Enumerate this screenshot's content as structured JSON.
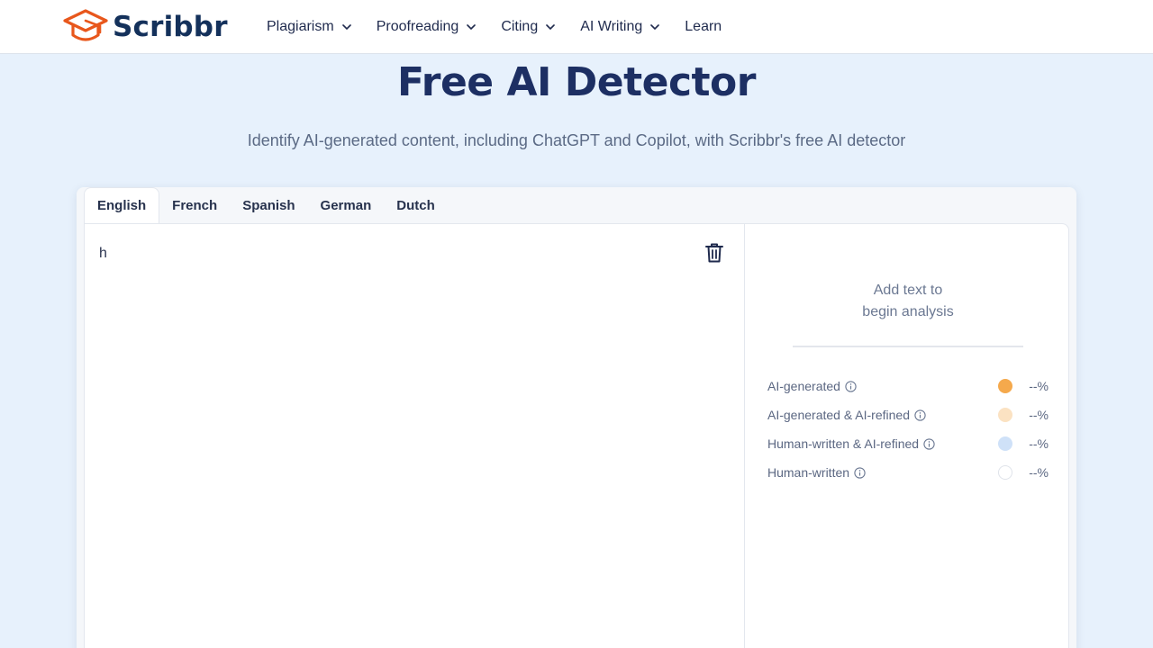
{
  "brand": {
    "name": "Scribbr",
    "color": "#e8571c",
    "text_color": "#14315b"
  },
  "nav": [
    {
      "label": "Plagiarism",
      "has_dropdown": true
    },
    {
      "label": "Proofreading",
      "has_dropdown": true
    },
    {
      "label": "Citing",
      "has_dropdown": true
    },
    {
      "label": "AI Writing",
      "has_dropdown": true
    },
    {
      "label": "Learn",
      "has_dropdown": false
    }
  ],
  "hero": {
    "title": "Free AI Detector",
    "subtitle": "Identify AI-generated content, including ChatGPT and Copilot, with Scribbr's free AI detector"
  },
  "tabs": [
    {
      "label": "English",
      "active": true
    },
    {
      "label": "French",
      "active": false
    },
    {
      "label": "Spanish",
      "active": false
    },
    {
      "label": "German",
      "active": false
    },
    {
      "label": "Dutch",
      "active": false
    }
  ],
  "editor": {
    "text": "h",
    "clear_icon": "trash-icon"
  },
  "results": {
    "empty_line1": "Add text to",
    "empty_line2": "begin analysis",
    "rows": [
      {
        "label": "AI-generated",
        "value": "--%",
        "color": "#f5a94c"
      },
      {
        "label": "AI-generated & AI-refined",
        "value": "--%",
        "color": "#fbe2c2"
      },
      {
        "label": "Human-written & AI-refined",
        "value": "--%",
        "color": "#cfe1f8"
      },
      {
        "label": "Human-written",
        "value": "--%",
        "color": "#ffffff"
      }
    ]
  }
}
